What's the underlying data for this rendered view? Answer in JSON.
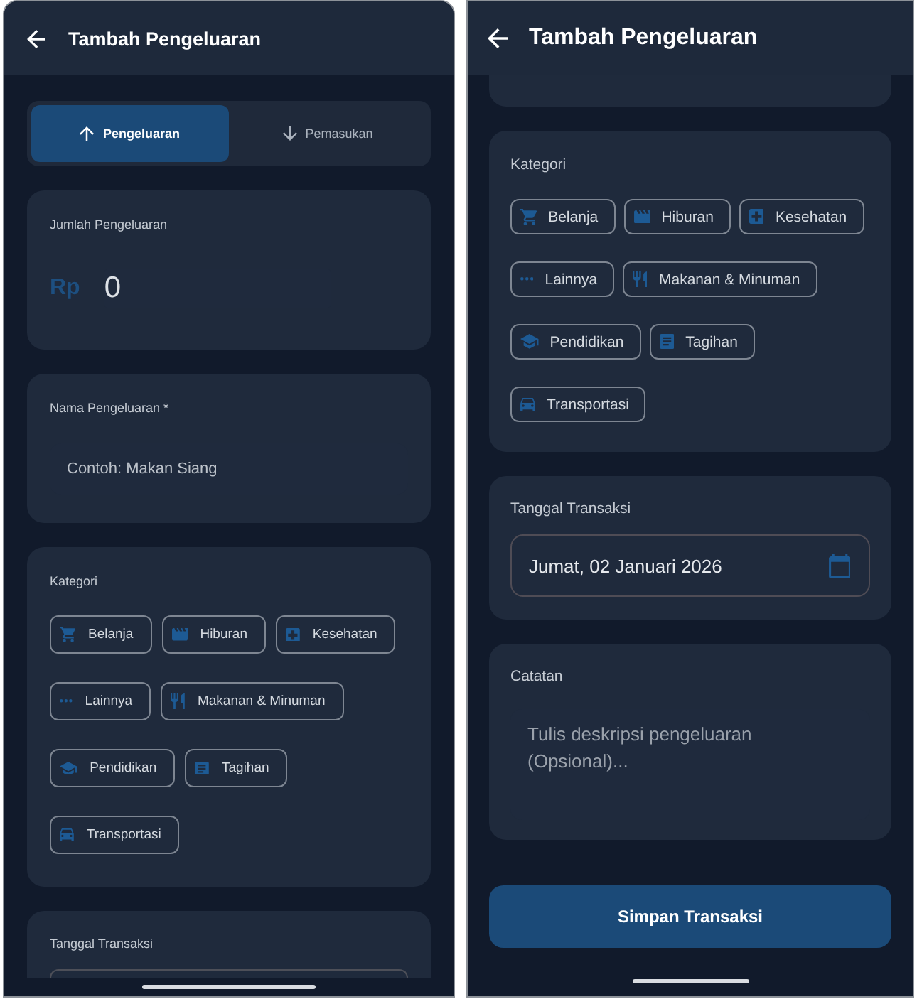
{
  "screens": [
    {
      "app_bar": {
        "title": "Tambah Pengeluaran"
      },
      "type_toggle": [
        {
          "label": "Pengeluaran",
          "selected": true
        },
        {
          "label": "Pemasukan",
          "selected": false
        }
      ],
      "sections": [
        {
          "kind": "amount",
          "label": "Jumlah Pengeluaran",
          "currency": "Rp",
          "value": "0"
        },
        {
          "kind": "text",
          "label": "Nama Pengeluaran *",
          "placeholder": "Contoh: Makan Siang"
        },
        {
          "kind": "categories",
          "label": "Kategori",
          "categories": [
            {
              "label": "Belanja",
              "selected": false
            },
            {
              "label": "Hiburan",
              "selected": false
            },
            {
              "label": "Kesehatan",
              "selected": false
            },
            {
              "label": "Lainnya",
              "selected": false
            },
            {
              "label": "Makanan & Minuman",
              "selected": false
            },
            {
              "label": "Pendidikan",
              "selected": false
            },
            {
              "label": "Tagihan",
              "selected": false
            },
            {
              "label": "Transportasi",
              "selected": false
            }
          ]
        },
        {
          "kind": "date",
          "label": "Tanggal Transaksi"
        }
      ]
    },
    {
      "app_bar": {
        "title": "Tambah Pengeluaran"
      },
      "sections": [
        {
          "kind": "categories",
          "label": "Kategori",
          "categories": [
            {
              "label": "Belanja",
              "selected": false
            },
            {
              "label": "Hiburan",
              "selected": false
            },
            {
              "label": "Kesehatan",
              "selected": false
            },
            {
              "label": "Lainnya",
              "selected": false
            },
            {
              "label": "Makanan & Minuman",
              "selected": false
            },
            {
              "label": "Pendidikan",
              "selected": false
            },
            {
              "label": "Tagihan",
              "selected": false
            },
            {
              "label": "Transportasi",
              "selected": false
            }
          ]
        },
        {
          "kind": "date",
          "label": "Tanggal Transaksi",
          "value": "Jumat, 02 Januari 2026"
        },
        {
          "kind": "notes",
          "label": "Catatan",
          "placeholder": "Tulis deskripsi pengeluaran (Opsional)..."
        }
      ],
      "save_button": {
        "label": "Simpan Transaksi"
      }
    }
  ]
}
